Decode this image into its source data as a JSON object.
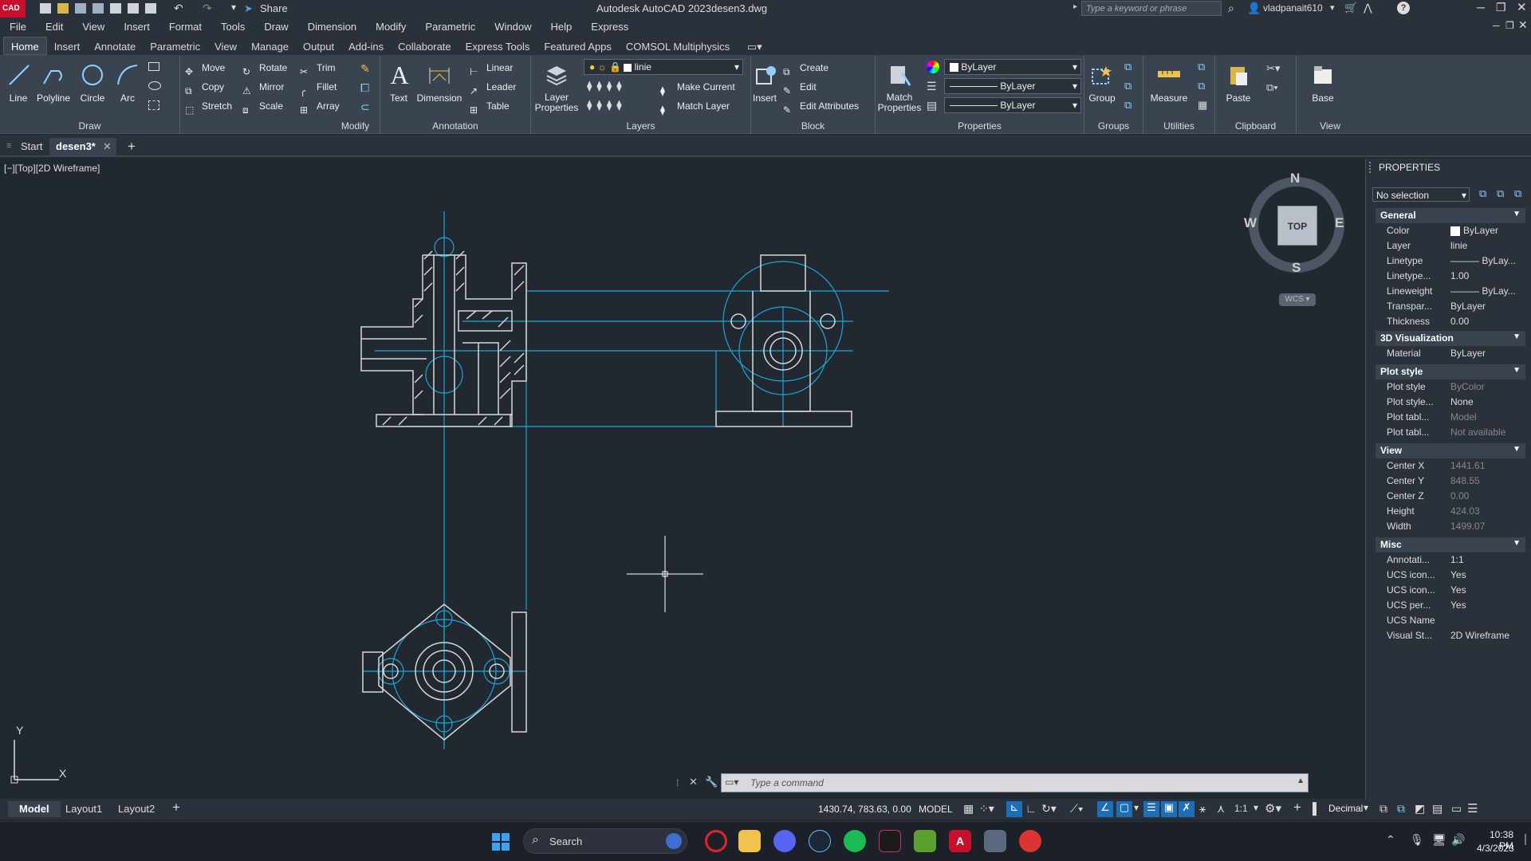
{
  "app": {
    "logo_text": "CAD",
    "window_title": "Autodesk AutoCAD 2023",
    "file_name": "desen3.dwg",
    "share_label": "Share",
    "search_placeholder": "Type a keyword or phrase",
    "user_name": "vladpanait610"
  },
  "menu": [
    "File",
    "Edit",
    "View",
    "Insert",
    "Format",
    "Tools",
    "Draw",
    "Dimension",
    "Modify",
    "Parametric",
    "Window",
    "Help",
    "Express"
  ],
  "ribbon_tabs": [
    "Home",
    "Insert",
    "Annotate",
    "Parametric",
    "View",
    "Manage",
    "Output",
    "Add-ins",
    "Collaborate",
    "Express Tools",
    "Featured Apps",
    "COMSOL Multiphysics"
  ],
  "panels": {
    "draw": {
      "title": "Draw",
      "line": "Line",
      "polyline": "Polyline",
      "circle": "Circle",
      "arc": "Arc"
    },
    "modify": {
      "title": "Modify",
      "move": "Move",
      "rotate": "Rotate",
      "trim": "Trim",
      "copy": "Copy",
      "mirror": "Mirror",
      "fillet": "Fillet",
      "stretch": "Stretch",
      "scale": "Scale",
      "array": "Array"
    },
    "annotation": {
      "title": "Annotation",
      "text": "Text",
      "dimension": "Dimension",
      "linear": "Linear",
      "leader": "Leader",
      "table": "Table"
    },
    "layers": {
      "title": "Layers",
      "layer_properties": "Layer Properties",
      "current_layer": "linie",
      "make_current": "Make Current",
      "match_layer": "Match Layer"
    },
    "block": {
      "title": "Block",
      "insert": "Insert",
      "create": "Create",
      "edit": "Edit",
      "edit_attributes": "Edit Attributes"
    },
    "properties": {
      "title": "Properties",
      "match_properties": "Match Properties",
      "color": "ByLayer",
      "lineweight": "ByLayer",
      "linetype": "ByLayer"
    },
    "groups": {
      "title": "Groups",
      "group": "Group"
    },
    "utilities": {
      "title": "Utilities",
      "measure": "Measure"
    },
    "clipboard": {
      "title": "Clipboard",
      "paste": "Paste"
    },
    "view": {
      "title": "View",
      "base": "Base"
    }
  },
  "doc_tabs": {
    "start": "Start",
    "current": "desen3*"
  },
  "viewport": {
    "label": "[−][Top][2D Wireframe]",
    "viewcube": {
      "n": "N",
      "s": "S",
      "e": "E",
      "w": "W",
      "top": "TOP",
      "wcs": "WCS"
    },
    "ucs": {
      "x": "X",
      "y": "Y"
    }
  },
  "properties_palette": {
    "title": "PROPERTIES",
    "selection": "No selection",
    "sections": {
      "general": "General",
      "viz": "3D Visualization",
      "plot": "Plot style",
      "view": "View",
      "misc": "Misc"
    },
    "general": [
      [
        "Color",
        "ByLayer"
      ],
      [
        "Layer",
        "linie"
      ],
      [
        "Linetype",
        "——— ByLay..."
      ],
      [
        "Linetype...",
        "1.00"
      ],
      [
        "Lineweight",
        "——— ByLay..."
      ],
      [
        "Transpar...",
        "ByLayer"
      ],
      [
        "Thickness",
        "0.00"
      ]
    ],
    "viz": [
      [
        "Material",
        "ByLayer"
      ]
    ],
    "plot": [
      [
        "Plot style",
        "ByColor"
      ],
      [
        "Plot style...",
        "None"
      ],
      [
        "Plot tabl...",
        "Model"
      ],
      [
        "Plot tabl...",
        "Not available"
      ]
    ],
    "view": [
      [
        "Center X",
        "1441.61"
      ],
      [
        "Center Y",
        "848.55"
      ],
      [
        "Center Z",
        "0.00"
      ],
      [
        "Height",
        "424.03"
      ],
      [
        "Width",
        "1499.07"
      ]
    ],
    "misc": [
      [
        "Annotati...",
        "1:1"
      ],
      [
        "UCS icon...",
        "Yes"
      ],
      [
        "UCS icon...",
        "Yes"
      ],
      [
        "UCS per...",
        "Yes"
      ],
      [
        "UCS Name",
        ""
      ],
      [
        "Visual St...",
        "2D Wireframe"
      ]
    ]
  },
  "command": {
    "placeholder": "Type a command"
  },
  "layout_tabs": [
    "Model",
    "Layout1",
    "Layout2"
  ],
  "status": {
    "coords": "1430.74, 783.63, 0.00",
    "space": "MODEL",
    "scale": "1:1",
    "units": "Decimal"
  },
  "taskbar": {
    "search": "Search",
    "time": "10:38 PM",
    "date": "4/3/2023"
  },
  "colors": {
    "accent": "#1ba1e2",
    "drawing_line": "#d7d7d7",
    "center_line": "#1aa7d8",
    "brand_red": "#d0021b"
  }
}
